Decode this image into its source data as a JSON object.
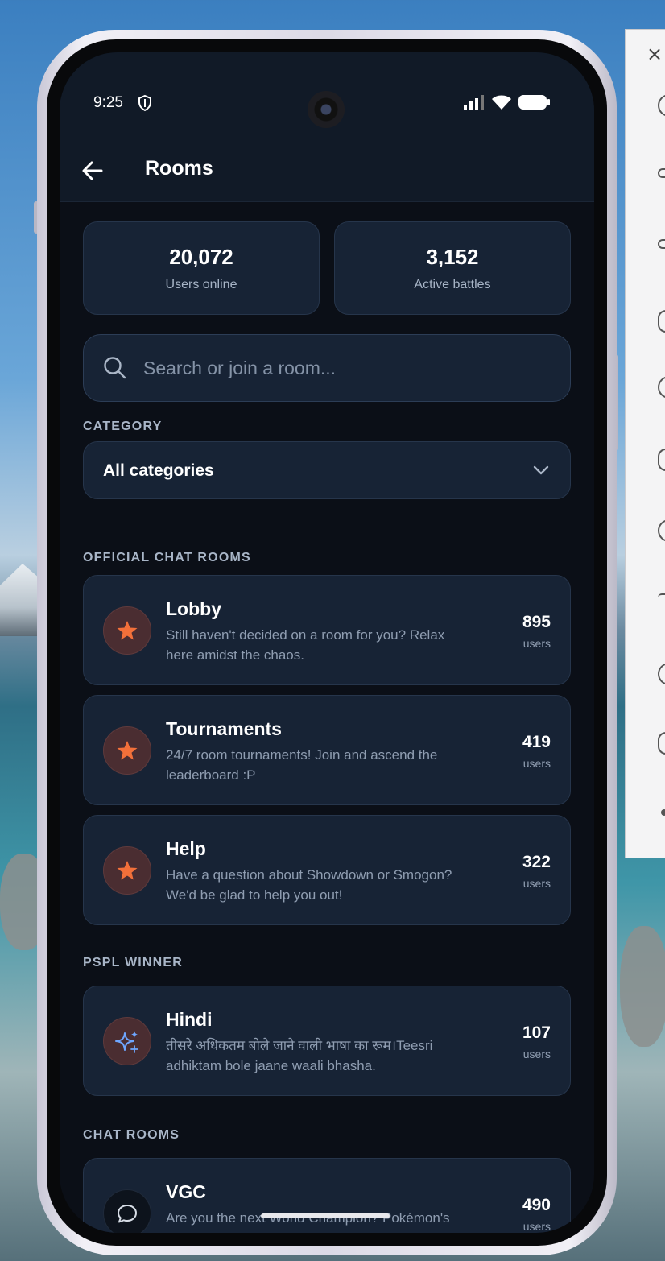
{
  "status_bar": {
    "time": "9:25"
  },
  "app_bar": {
    "title": "Rooms"
  },
  "stats": [
    {
      "value": "20,072",
      "label": "Users online"
    },
    {
      "value": "3,152",
      "label": "Active battles"
    }
  ],
  "search": {
    "placeholder": "Search or join a room...",
    "value": ""
  },
  "category": {
    "label": "CATEGORY",
    "selected": "All categories"
  },
  "sections": {
    "official": "OFFICIAL CHAT ROOMS",
    "pspl": "PSPL WINNER",
    "chat": "CHAT ROOMS"
  },
  "rooms": [
    {
      "name": "Lobby",
      "desc": "Still haven't decided on a room for you? Relax here amidst the chaos.",
      "count": "895",
      "unit": "users",
      "icon": "star-icon"
    },
    {
      "name": "Tournaments",
      "desc": "24/7 room tournaments! Join and ascend the leaderboard :P",
      "count": "419",
      "unit": "users",
      "icon": "star-icon"
    },
    {
      "name": "Help",
      "desc": "Have a question about Showdown or Smogon? We'd be glad to help you out!",
      "count": "322",
      "unit": "users",
      "icon": "star-icon"
    },
    {
      "name": "Hindi",
      "desc": "तीसरे अधिकतम बोले जाने वाली भाषा का रूम।Teesri adhiktam bole jaane waali bhasha.",
      "count": "107",
      "unit": "users",
      "icon": "sparkle-icon"
    },
    {
      "name": "VGC",
      "desc": "Are you the next World Champion? Pokémon's official competitive format!",
      "count": "490",
      "unit": "users",
      "icon": "chat-bubble-icon"
    }
  ],
  "colors": {
    "accent_orange": "#f2703a",
    "sparkle_blue": "#6ea6ff",
    "background": "#0b0f17",
    "card": "#172335"
  }
}
